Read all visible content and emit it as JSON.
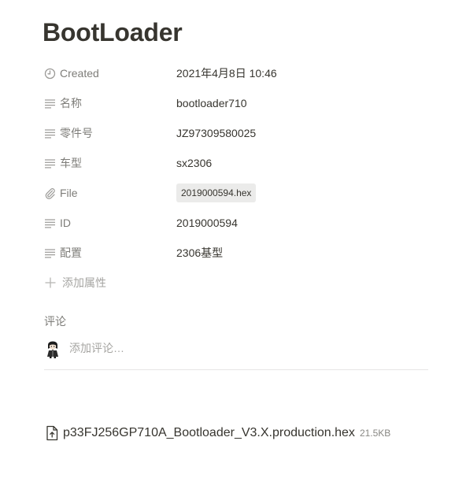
{
  "page": {
    "title": "BootLoader"
  },
  "properties": [
    {
      "name": "Created",
      "value": "2021年4月8日 10:46",
      "icon": "clock-icon"
    },
    {
      "name": "名称",
      "value": "bootloader710",
      "icon": "text-lines-icon"
    },
    {
      "name": "零件号",
      "value": "JZ97309580025",
      "icon": "text-lines-icon"
    },
    {
      "name": "车型",
      "value": "sx2306",
      "icon": "text-lines-icon"
    },
    {
      "name": "File",
      "value": "2019000594.hex",
      "icon": "paperclip-icon"
    },
    {
      "name": "ID",
      "value": "2019000594",
      "icon": "text-lines-icon"
    },
    {
      "name": "配置",
      "value": "2306基型",
      "icon": "text-lines-icon"
    }
  ],
  "add_property": {
    "label": "添加属性",
    "icon": "plus-icon"
  },
  "comments": {
    "label": "评论",
    "placeholder": "添加评论…",
    "avatar_icon": "user-avatar-icon"
  },
  "attachment": {
    "name": "p33FJ256GP710A_Bootloader_V3.X.production.hex",
    "size": "21.5KB",
    "icon": "file-upload-icon"
  },
  "colors": {
    "text": "#37352f",
    "muted": "#9b9a97",
    "chip_bg": "#ebebea",
    "divider": "#e9e9e7"
  }
}
